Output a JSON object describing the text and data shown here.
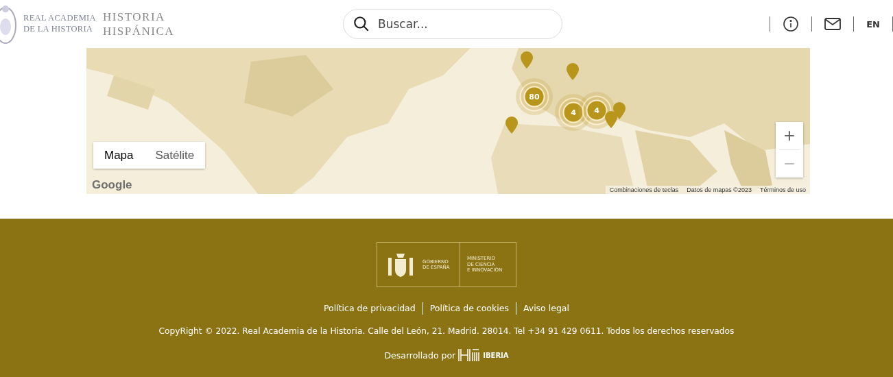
{
  "header": {
    "academy_name": [
      "REAL ACADEMIA",
      "DE LA HISTORIA"
    ],
    "site_name": [
      "HISTORIA",
      "HISPÁNICA"
    ],
    "search": {
      "placeholder": "Buscar..."
    },
    "language": "EN"
  },
  "map": {
    "type_toggle": [
      {
        "label": "Mapa",
        "selected": true
      },
      {
        "label": "Satélite",
        "selected": false
      }
    ],
    "markers": [
      {
        "kind": "pin"
      },
      {
        "kind": "pin"
      },
      {
        "kind": "cluster",
        "label": "80"
      },
      {
        "kind": "cluster",
        "label": "4"
      },
      {
        "kind": "cluster",
        "label": "4"
      },
      {
        "kind": "pin"
      },
      {
        "kind": "pin"
      },
      {
        "kind": "pin"
      }
    ],
    "zoom": {
      "in": "+",
      "out": "−"
    },
    "provider_logo": "Google",
    "attribution": [
      "Combinaciones de teclas",
      "Datos de mapas ©2023",
      "Términos de uso"
    ]
  },
  "footer": {
    "government": [
      "GOBIERNO",
      "DE ESPAÑA"
    ],
    "ministry": [
      "MINISTERIO",
      "DE CIENCIA",
      "E INNOVACIÓN"
    ],
    "links": [
      "Política de privacidad",
      "Política de cookies",
      "Aviso legal"
    ],
    "copyright": "CopyRight © 2022. Real Academia de la Historia. Calle del León, 21. Madrid. 28014. Tel +34 91 429 0611. Todos los derechos reservados",
    "developed_by": "Desarrollado por",
    "developer": "IBERIA"
  }
}
